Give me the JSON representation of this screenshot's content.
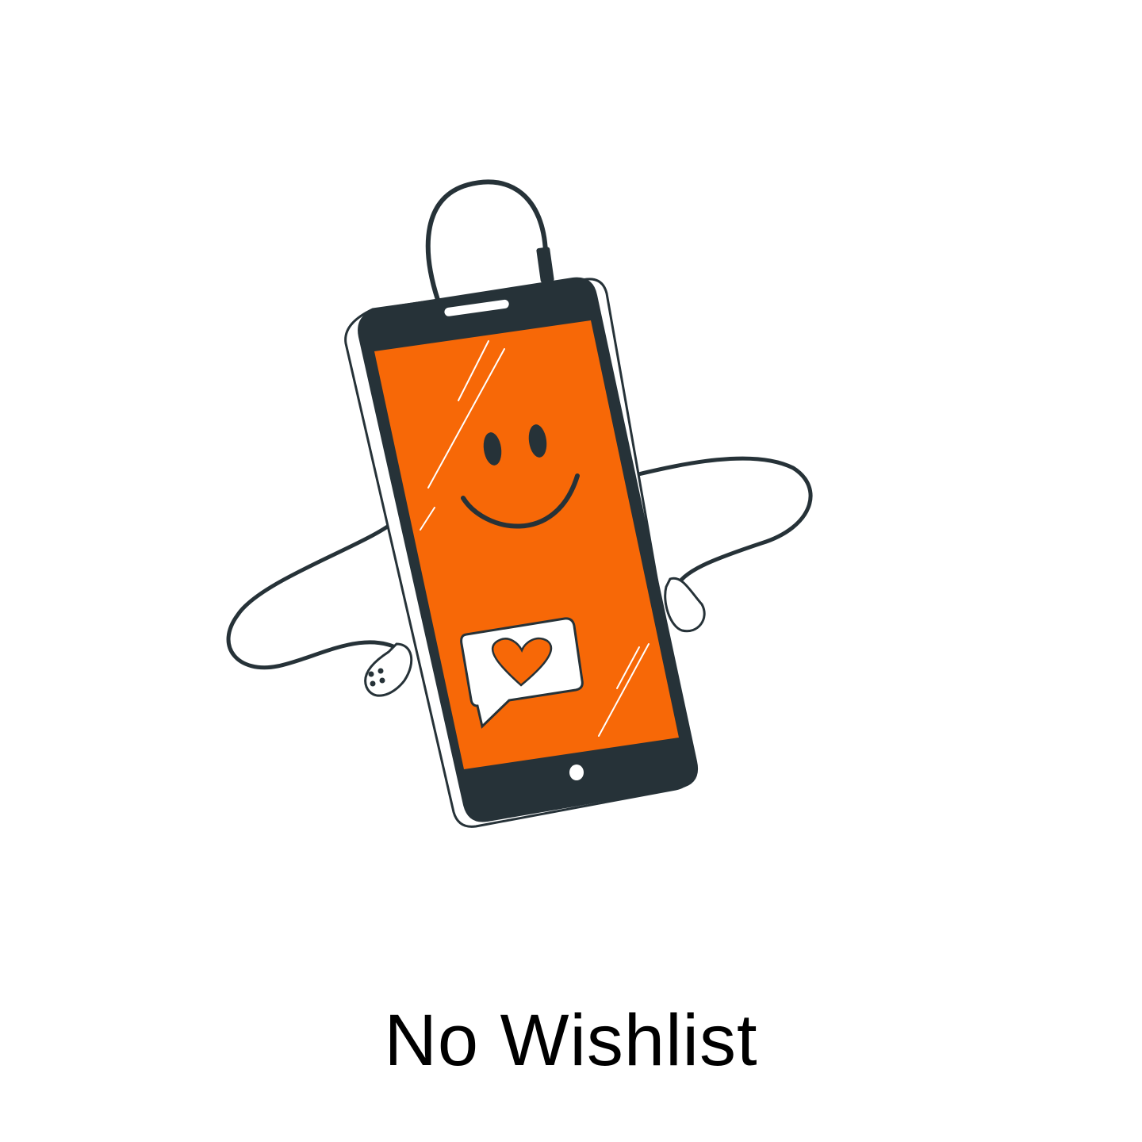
{
  "empty_state": {
    "title": "No Wishlist",
    "illustration": "smiling-phone-with-earphones-and-heart-message",
    "accent_color": "#F76807",
    "outline_color": "#263238",
    "background_color": "#FFFFFF"
  }
}
